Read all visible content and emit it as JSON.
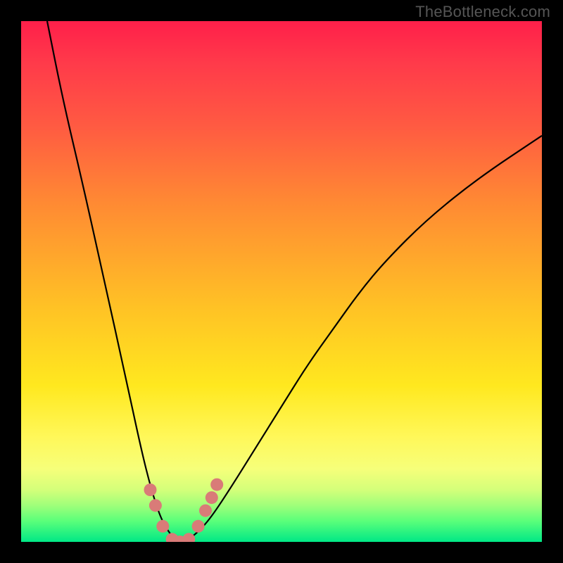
{
  "watermark": "TheBottleneck.com",
  "colors": {
    "frame": "#000000",
    "curve": "#000000",
    "marker": "#d97b78",
    "gradient_top": "#ff1f4a",
    "gradient_bottom": "#00e886"
  },
  "chart_data": {
    "type": "line",
    "title": "",
    "xlabel": "",
    "ylabel": "",
    "xlim": [
      0,
      100
    ],
    "ylim": [
      0,
      100
    ],
    "note": "No axis ticks or numeric labels are rendered; values are proportional estimates from pixel positions (0=left/bottom, 100=right/top).",
    "series": [
      {
        "name": "bottleneck-curve",
        "x": [
          5,
          8,
          12,
          16,
          20,
          23,
          25,
          27,
          29,
          30,
          31,
          33,
          36,
          40,
          45,
          50,
          55,
          60,
          65,
          70,
          78,
          88,
          100
        ],
        "y": [
          100,
          85,
          68,
          50,
          32,
          18,
          10,
          4,
          1,
          0,
          0,
          1,
          4,
          10,
          18,
          26,
          34,
          41,
          48,
          54,
          62,
          70,
          78
        ]
      }
    ],
    "markers": {
      "name": "highlighted-points",
      "x": [
        24.8,
        25.8,
        27.2,
        29.0,
        30.5,
        32.2,
        34.0,
        35.4,
        36.6,
        37.6
      ],
      "y": [
        10.0,
        7.0,
        3.0,
        0.5,
        0.0,
        0.5,
        3.0,
        6.0,
        8.5,
        11.0
      ]
    }
  }
}
